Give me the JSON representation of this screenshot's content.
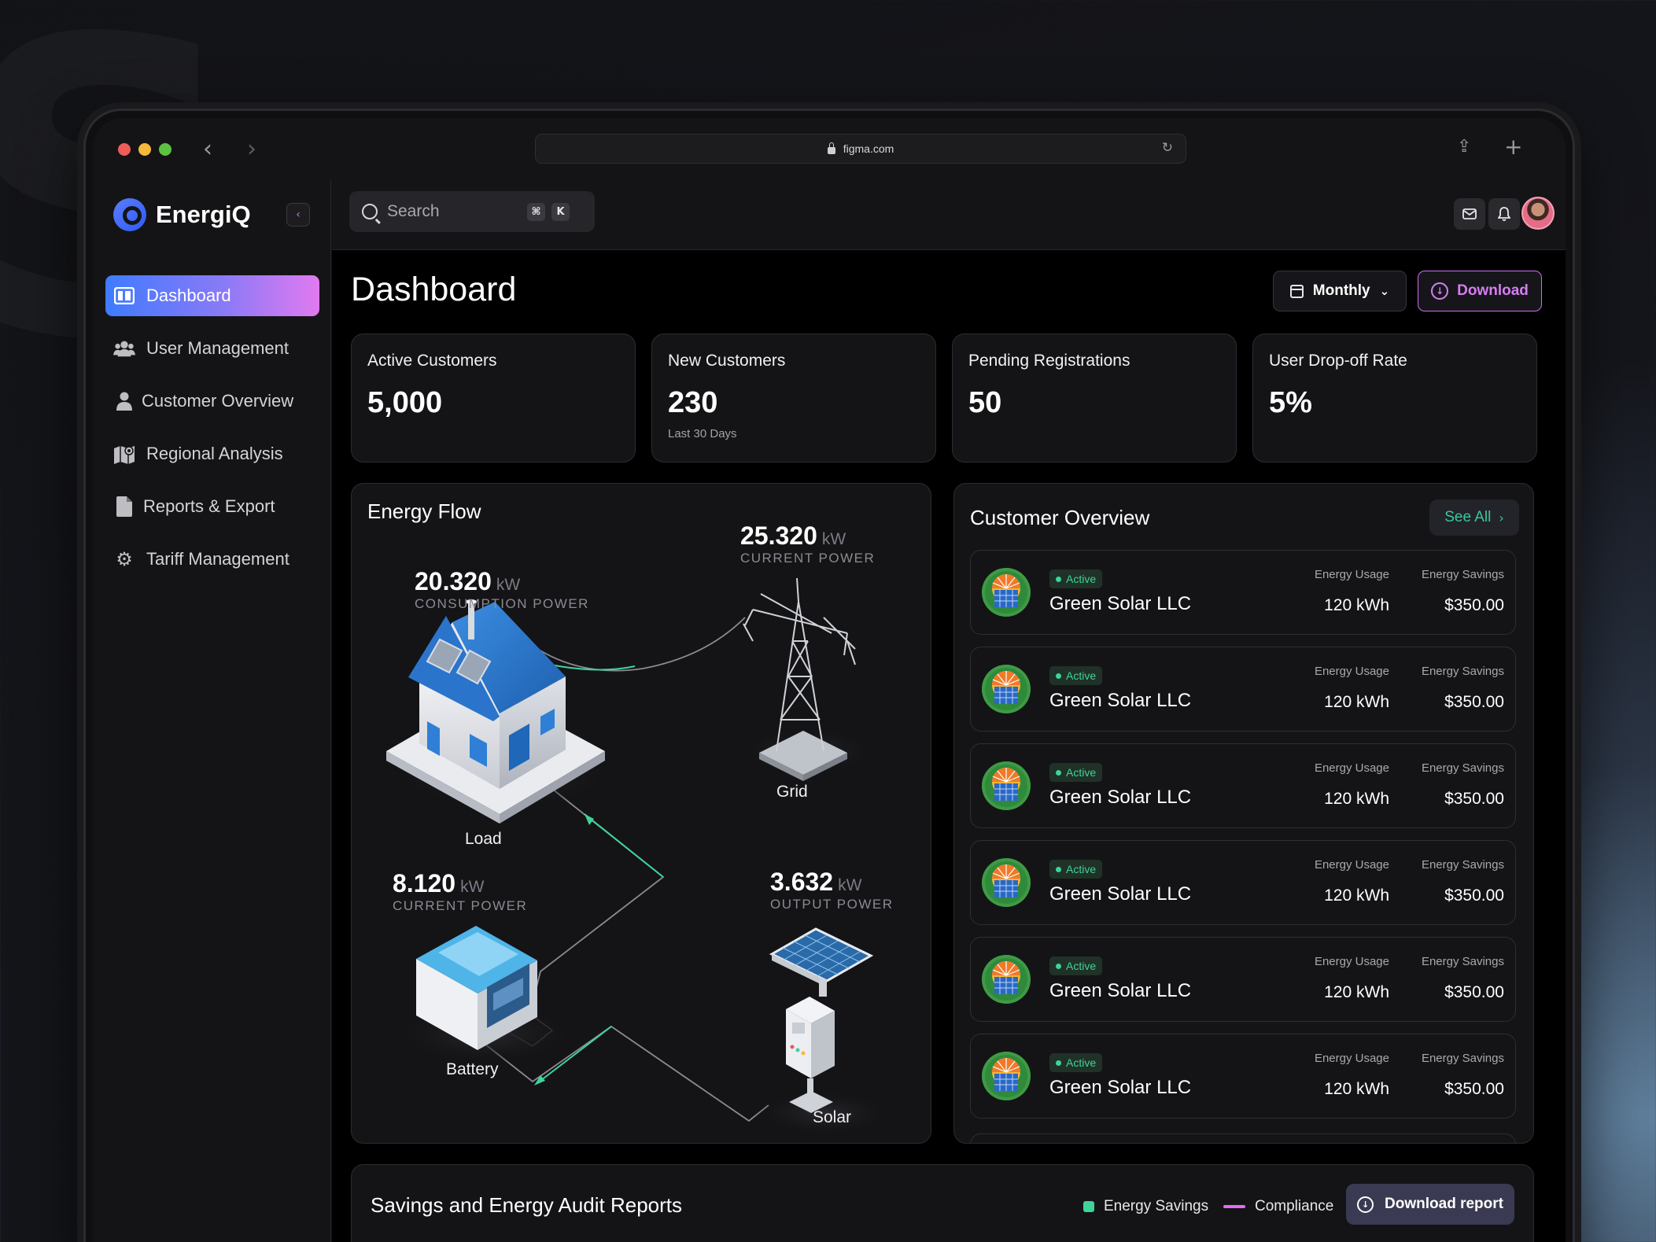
{
  "browser": {
    "url": "figma.com"
  },
  "brand": {
    "name": "EnergiQ"
  },
  "sidebar": {
    "items": [
      {
        "label": "Dashboard",
        "icon": "dashboard-icon",
        "active": true
      },
      {
        "label": "User Management",
        "icon": "users-icon"
      },
      {
        "label": "Customer Overview",
        "icon": "user-icon"
      },
      {
        "label": "Regional Analysis",
        "icon": "map-icon"
      },
      {
        "label": "Reports & Export",
        "icon": "document-icon"
      },
      {
        "label": "Tariff Management",
        "icon": "gear-icon"
      }
    ]
  },
  "search": {
    "placeholder": "Search",
    "shortcut_1": "⌘",
    "shortcut_2": "K"
  },
  "header": {
    "title": "Dashboard",
    "period": "Monthly",
    "download_label": "Download"
  },
  "stats": [
    {
      "label": "Active Customers",
      "value": "5,000",
      "sub": ""
    },
    {
      "label": "New Customers",
      "value": "230",
      "sub": "Last 30 Days"
    },
    {
      "label": "Pending Registrations",
      "value": "50",
      "sub": ""
    },
    {
      "label": "User Drop-off Rate",
      "value": "5%",
      "sub": ""
    }
  ],
  "energy_flow": {
    "title": "Energy Flow",
    "consumption": {
      "value": "20.320",
      "unit": "kW",
      "caption": "CONSUMPTION POWER"
    },
    "grid": {
      "value": "25.320",
      "unit": "kW",
      "caption": "CURRENT POWER"
    },
    "battery": {
      "value": "8.120",
      "unit": "kW",
      "caption": "CURRENT POWER"
    },
    "solar": {
      "value": "3.632",
      "unit": "kW",
      "caption": "OUTPUT POWER"
    },
    "labels": {
      "load": "Load",
      "grid": "Grid",
      "battery": "Battery",
      "solar": "Solar"
    }
  },
  "customer_overview": {
    "title": "Customer Overview",
    "see_all": "See All",
    "col_usage": "Energy Usage",
    "col_savings": "Energy Savings",
    "rows": [
      {
        "status": "Active",
        "name": "Green Solar LLC",
        "usage": "120 kWh",
        "savings": "$350.00"
      },
      {
        "status": "Active",
        "name": "Green Solar LLC",
        "usage": "120 kWh",
        "savings": "$350.00"
      },
      {
        "status": "Active",
        "name": "Green Solar LLC",
        "usage": "120 kWh",
        "savings": "$350.00"
      },
      {
        "status": "Active",
        "name": "Green Solar LLC",
        "usage": "120 kWh",
        "savings": "$350.00"
      },
      {
        "status": "Active",
        "name": "Green Solar LLC",
        "usage": "120 kWh",
        "savings": "$350.00"
      },
      {
        "status": "Active",
        "name": "Green Solar LLC",
        "usage": "120 kWh",
        "savings": "$350.00"
      }
    ]
  },
  "reports": {
    "title": "Savings and Energy Audit Reports",
    "legend_savings": "Energy Savings",
    "legend_compliance": "Compliance",
    "download_label": "Download report",
    "colors": {
      "savings": "#3fd39a",
      "compliance": "#e36cf0"
    }
  }
}
